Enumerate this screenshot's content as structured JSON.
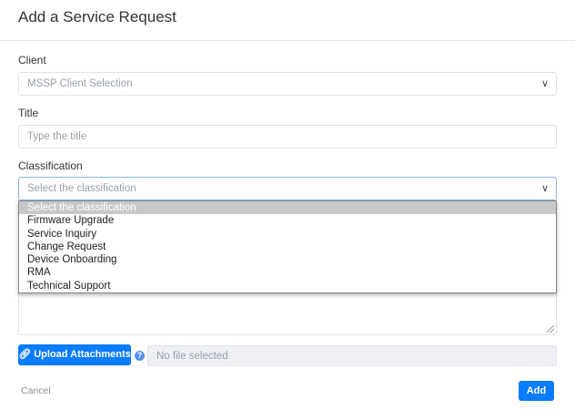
{
  "dialog": {
    "title": "Add a Service Request"
  },
  "client": {
    "label": "Client",
    "placeholder": "MSSP Client Selection"
  },
  "title_field": {
    "label": "Title",
    "placeholder": "Type the title"
  },
  "classification": {
    "label": "Classification",
    "placeholder": "Select the classification",
    "options": [
      "Select the classification",
      "Firmware Upgrade",
      "Service Inquiry",
      "Change Request",
      "Device Onboarding",
      "RMA",
      "Technical Support"
    ]
  },
  "attachments": {
    "button": "Upload Attachments",
    "help": "?",
    "file_status": "No file selected"
  },
  "footer": {
    "cancel": "Cancel",
    "add": "Add"
  },
  "colors": {
    "primary": "#0a7cff"
  }
}
